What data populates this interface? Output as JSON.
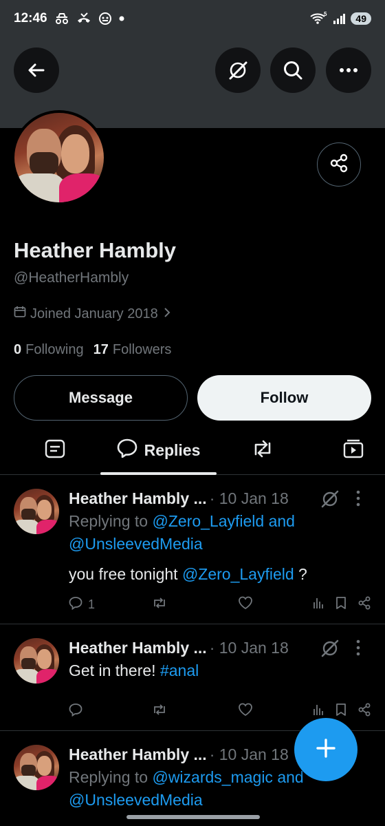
{
  "status": {
    "time": "12:46",
    "battery": "49",
    "signal_sup": "5"
  },
  "profile": {
    "name": "Heather Hambly",
    "handle": "@HeatherHambly",
    "joined": "Joined January 2018",
    "following_count": "0",
    "following_label": "Following",
    "followers_count": "17",
    "followers_label": "Followers"
  },
  "buttons": {
    "message": "Message",
    "follow": "Follow"
  },
  "tabs": {
    "active_label": "Replies"
  },
  "tweets": [
    {
      "name": "Heather Hambly ...",
      "meta": "· 10 Jan 18",
      "replying_prefix": "Replying to ",
      "replying_to_1": "@Zero_Layfield and",
      "replying_to_2": "@UnsleevedMedia",
      "text_prefix": "you free tonight ",
      "text_link": "@Zero_Layfield",
      "text_suffix": " ?",
      "reply_count": "1"
    },
    {
      "name": "Heather Hambly ...",
      "meta": "· 10 Jan 18",
      "text_prefix": "Get in there! ",
      "text_link": "#anal"
    },
    {
      "name": "Heather Hambly ...",
      "meta": "· 10 Jan 18",
      "replying_prefix": "Replying to ",
      "replying_to_1": "@wizards_magic and",
      "replying_to_2": "@UnsleevedMedia"
    }
  ],
  "icons": {
    "back": "arrow-left-icon",
    "grok": "grok-icon",
    "search": "search-icon",
    "more": "more-icon",
    "share": "share-icon",
    "calendar": "calendar-icon",
    "posts": "posts-icon",
    "reply": "reply-icon",
    "retweet": "retweet-icon",
    "media": "media-icon",
    "like": "heart-icon",
    "views": "views-icon",
    "bookmark": "bookmark-icon",
    "compose": "plus-icon"
  },
  "colors": {
    "accent": "#1d9bf0",
    "background": "#000000",
    "banner": "#2f3336",
    "muted": "#71767b",
    "text": "#e7e9ea"
  }
}
